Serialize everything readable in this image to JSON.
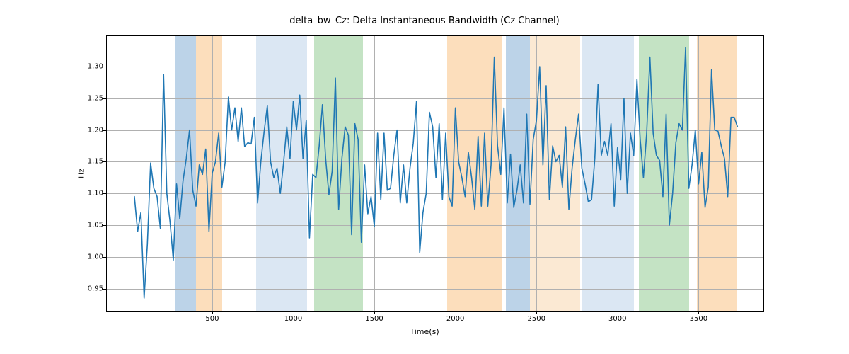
{
  "chart_data": {
    "type": "line",
    "title": "delta_bw_Cz: Delta Instantaneous Bandwidth (Cz Channel)",
    "xlabel": "Time(s)",
    "ylabel": "Hz",
    "xlim": [
      -150,
      3900
    ],
    "ylim": [
      0.915,
      1.348
    ],
    "xticks": [
      500,
      1000,
      1500,
      2000,
      2500,
      3000,
      3500
    ],
    "yticks": [
      0.95,
      1.0,
      1.05,
      1.1,
      1.15,
      1.2,
      1.25,
      1.3
    ],
    "ytick_labels": [
      "0.95",
      "1.00",
      "1.05",
      "1.10",
      "1.15",
      "1.20",
      "1.25",
      "1.30"
    ],
    "bands": [
      {
        "x0": 270,
        "x1": 400,
        "color": "#bcd3e8"
      },
      {
        "x0": 400,
        "x1": 560,
        "color": "#fcdebc"
      },
      {
        "x0": 770,
        "x1": 1085,
        "color": "#dbe7f3"
      },
      {
        "x0": 1130,
        "x1": 1430,
        "color": "#c4e3c4"
      },
      {
        "x0": 1950,
        "x1": 2290,
        "color": "#fcdebc"
      },
      {
        "x0": 2310,
        "x1": 2460,
        "color": "#bcd3e8"
      },
      {
        "x0": 2460,
        "x1": 2770,
        "color": "#fbe9d3"
      },
      {
        "x0": 2780,
        "x1": 3100,
        "color": "#dbe7f3"
      },
      {
        "x0": 3130,
        "x1": 3440,
        "color": "#c4e3c4"
      },
      {
        "x0": 3490,
        "x1": 3740,
        "color": "#fcdebc"
      }
    ],
    "line_color": "#1f77b4",
    "x": [
      20,
      40,
      60,
      80,
      100,
      120,
      140,
      160,
      180,
      200,
      220,
      240,
      260,
      280,
      300,
      320,
      340,
      360,
      380,
      400,
      420,
      440,
      460,
      480,
      500,
      520,
      540,
      560,
      580,
      600,
      620,
      640,
      660,
      680,
      700,
      720,
      740,
      760,
      780,
      800,
      820,
      840,
      860,
      880,
      900,
      920,
      940,
      960,
      980,
      1000,
      1020,
      1040,
      1060,
      1080,
      1100,
      1120,
      1140,
      1160,
      1180,
      1200,
      1220,
      1240,
      1260,
      1280,
      1300,
      1320,
      1340,
      1360,
      1380,
      1400,
      1420,
      1440,
      1460,
      1480,
      1500,
      1520,
      1540,
      1560,
      1580,
      1600,
      1620,
      1640,
      1660,
      1680,
      1700,
      1720,
      1740,
      1760,
      1780,
      1800,
      1820,
      1840,
      1860,
      1880,
      1900,
      1920,
      1940,
      1960,
      1980,
      2000,
      2020,
      2040,
      2060,
      2080,
      2100,
      2120,
      2140,
      2160,
      2180,
      2200,
      2220,
      2240,
      2260,
      2280,
      2300,
      2320,
      2340,
      2360,
      2380,
      2400,
      2420,
      2440,
      2460,
      2480,
      2500,
      2520,
      2540,
      2560,
      2580,
      2600,
      2620,
      2640,
      2660,
      2680,
      2700,
      2720,
      2740,
      2760,
      2780,
      2800,
      2820,
      2840,
      2860,
      2880,
      2900,
      2920,
      2940,
      2960,
      2980,
      3000,
      3020,
      3040,
      3060,
      3080,
      3100,
      3120,
      3140,
      3160,
      3180,
      3200,
      3220,
      3240,
      3260,
      3280,
      3300,
      3320,
      3340,
      3360,
      3380,
      3400,
      3420,
      3440,
      3460,
      3480,
      3500,
      3520,
      3540,
      3560,
      3580,
      3600,
      3620,
      3640,
      3660,
      3680,
      3700,
      3720,
      3740
    ],
    "values": [
      1.095,
      1.04,
      1.07,
      0.935,
      1.02,
      1.148,
      1.108,
      1.095,
      1.045,
      1.288,
      1.1,
      1.055,
      0.995,
      1.115,
      1.06,
      1.12,
      1.155,
      1.2,
      1.105,
      1.08,
      1.145,
      1.13,
      1.17,
      1.04,
      1.132,
      1.15,
      1.195,
      1.11,
      1.15,
      1.252,
      1.2,
      1.235,
      1.182,
      1.235,
      1.174,
      1.18,
      1.178,
      1.22,
      1.085,
      1.15,
      1.197,
      1.238,
      1.15,
      1.125,
      1.14,
      1.1,
      1.148,
      1.205,
      1.155,
      1.245,
      1.2,
      1.255,
      1.155,
      1.215,
      1.03,
      1.13,
      1.125,
      1.175,
      1.24,
      1.154,
      1.098,
      1.135,
      1.282,
      1.075,
      1.155,
      1.205,
      1.192,
      1.035,
      1.21,
      1.185,
      1.023,
      1.145,
      1.068,
      1.095,
      1.048,
      1.195,
      1.09,
      1.195,
      1.105,
      1.108,
      1.16,
      1.2,
      1.085,
      1.145,
      1.085,
      1.14,
      1.179,
      1.245,
      1.007,
      1.07,
      1.1,
      1.228,
      1.205,
      1.125,
      1.21,
      1.09,
      1.195,
      1.095,
      1.08,
      1.235,
      1.15,
      1.125,
      1.095,
      1.165,
      1.125,
      1.075,
      1.19,
      1.08,
      1.195,
      1.08,
      1.145,
      1.315,
      1.175,
      1.13,
      1.235,
      1.085,
      1.162,
      1.078,
      1.105,
      1.145,
      1.085,
      1.225,
      1.083,
      1.185,
      1.215,
      1.3,
      1.145,
      1.27,
      1.09,
      1.175,
      1.15,
      1.16,
      1.11,
      1.205,
      1.075,
      1.14,
      1.185,
      1.225,
      1.14,
      1.115,
      1.087,
      1.09,
      1.155,
      1.272,
      1.16,
      1.182,
      1.16,
      1.21,
      1.08,
      1.172,
      1.122,
      1.25,
      1.1,
      1.195,
      1.16,
      1.28,
      1.185,
      1.125,
      1.195,
      1.315,
      1.195,
      1.16,
      1.152,
      1.095,
      1.225,
      1.05,
      1.1,
      1.18,
      1.21,
      1.2,
      1.33,
      1.108,
      1.145,
      1.2,
      1.115,
      1.165,
      1.078,
      1.11,
      1.295,
      1.2,
      1.198,
      1.175,
      1.155,
      1.095,
      1.22,
      1.22,
      1.205
    ]
  }
}
